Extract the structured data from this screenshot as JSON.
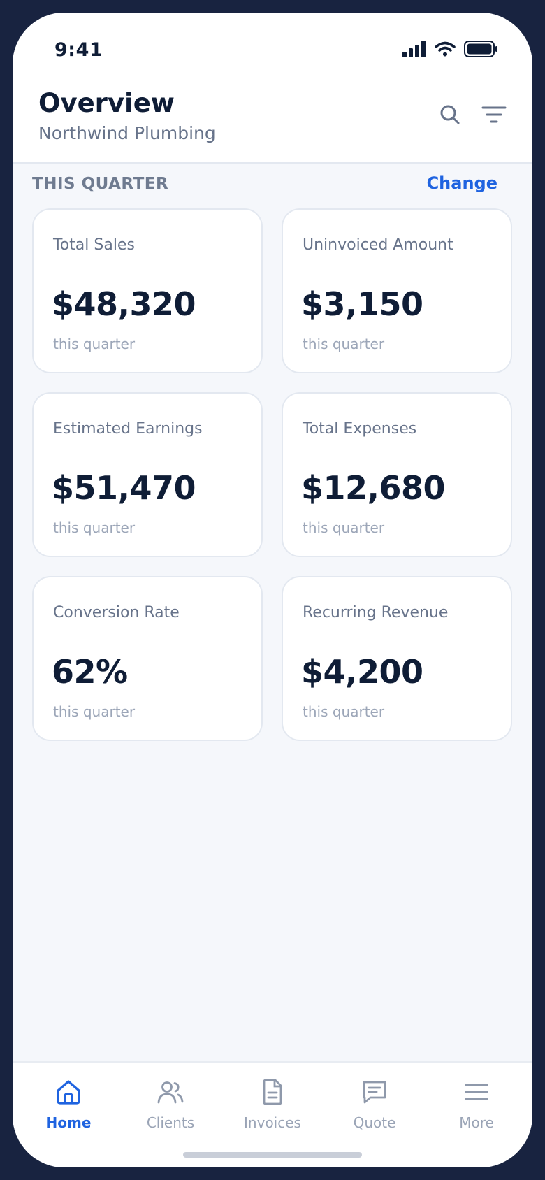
{
  "status_bar": {
    "time": "9:41"
  },
  "header": {
    "title": "Overview",
    "subtitle": "Northwind Plumbing"
  },
  "section": {
    "label": "THIS QUARTER",
    "change_label": "Change"
  },
  "cards": [
    {
      "label": "Total Sales",
      "value": "$48,320",
      "note": "this quarter"
    },
    {
      "label": "Uninvoiced Amount",
      "value": "$3,150",
      "note": "this quarter"
    },
    {
      "label": "Estimated Earnings",
      "value": "$51,470",
      "note": "this quarter"
    },
    {
      "label": "Total Expenses",
      "value": "$12,680",
      "note": "this quarter"
    },
    {
      "label": "Conversion Rate",
      "value": "62%",
      "note": "this quarter"
    },
    {
      "label": "Recurring Revenue",
      "value": "$4,200",
      "note": "this quarter"
    }
  ],
  "tabbar": {
    "active": "home",
    "items": [
      {
        "label": "Home",
        "icon": "home-icon"
      },
      {
        "label": "Clients",
        "icon": "clients-icon"
      },
      {
        "label": "Invoices",
        "icon": "invoice-icon"
      },
      {
        "label": "Quote",
        "icon": "quote-icon"
      },
      {
        "label": "More",
        "icon": "menu-icon"
      }
    ]
  },
  "colors": {
    "accent": "#1f63e0",
    "text_dark": "#0f1d36",
    "frame": "#182340"
  }
}
